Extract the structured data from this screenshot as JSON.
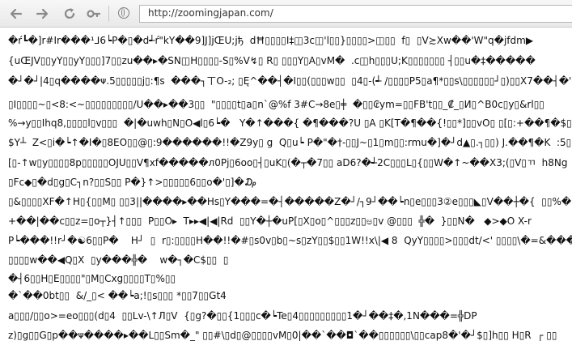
{
  "toolbar": {
    "back_icon": "back-arrow",
    "forward_icon": "forward-arrow",
    "reload_icon": "reload",
    "tools_icon": "wrench",
    "site_icon": "globe",
    "url": "http://zoomingjapan.com/"
  },
  "page": {
    "lines": [
      "�ŕ┗�]r#Ir���¹⅃6┕P�▯�d┵ŕ\"kY��9]J]jŒU;jђ  dĦ▯▯▯▯I‡◫3c◫'l▯▯}▯▯▯▯>◫▯▯  f▯  ▯V≿Xw��'W\"q�jfdm▶",
      "{uŒJV▯▯yY▯▯yY▯▯▯]7▯▯zu��▸�SN◫H▯▯▯▯-S▯%V↯▯ R▯ ▯▯▯Y▯A▯vM�  .c◫h▯▯▯U;K▯▯▯▯▯▯▯ ┤▯▯u�‡�����",
      "�┘�┘|4▯q����ᴪ.5▯▯▯▯▯j▯:¶s  ���┐ㄒO-₂; ▯Ę^��┤�I▯▯(▯▯▯w▯▯  ▯4▯-(┵ /▯▯▯▯P5▯a¶*▯▯s\\▯▯▯▯▯▯┘▯)▯▯X7��┤�'D",
      "▯I▯▯▯▯~▯<8:<~▯▯▯▯▯▯▯▯▯/U��▸��3▯▯  \"▯▯▯▯t▯a▯n`@%f 3#C→8e▯╪  �▯▯₢ym=▯▯FB't▯▯_₡_▯И▯^B0c▯y▯&rl▯▯",
      "%→y▯▯Ihq8,▯▯▯▯l▯v▯▯▯  �|�uwh▯N▯O◀l▯6┕�   Y�↑���{ �¶���?U ▯A ▯K[T�¶��{!▯▯*]▯▯vO▯ ▯[▯:+��¶�$▯▯V",
      "$Y┴  Z<▯i�┕↑�I�▯8EO▯▯@▯:9������!!�Z9y▯ g  Q▯u┕ P�\"�†-▯▯J~▯1▯m▯▯:rmu�]�┘d▲▯.┐▯▯) J.��¶�K  :5▯#8",
      "[▯-↑w▯y▯▯▯▯8p▯▯▯▯▯OJU▯▯V¶xf�����ᴫ0Pj▯6oo▯┤▯uK▯(�┬�7▯▯ aD6?�┵2C▯▯▯L▯{▯▯W�↑~��X3;(▯V▯ㄲ  h8Ng",
      "▯Fc◆▯�d▯g▯C┐n?▯▯S▯▯ P�}↑>▯▯▯▯▯6▯▯o�'▯]�₯",
      "▯&▯▯▯▯XF�↑H▯{▯▯M▯ ▯▯3||����▸��Hs▯Y���=�┤�����Z�┘/┐9┘��┕n▯e▯▯▯3②e▯▯▯◣▯V��┼�{  ▯▯%�¶]|8B-▯",
      "+��|��c▯▯z=▯o┬}┤↑▯▯▯  P▯▯O▸  T▸▸◀|◀|Rd  ▯▯Y�┼�uP[▯X▯o▯^▯▯▯z▯▯ಅ▯v @▯▯▯  ╬�  }▯▯N�   ◆>◆O X-r",
      "P┕���!!r┘�☯6▯▯P�    H┘  ▯  r▯:▯▯▯▯H��!!�#▯s0v▯b▯~s▯zY▯▯$▯▯1W!!x\\|◀ 8  QyY▯▯▯▯>▯▯▯dt/<' ▯▯▯▯\\�=&���",
      "▯▯▯▯w��◀Q▯X  ▯y���╬�    w�┐�C$▯▯  ▯",
      "�┤6▯▯H▯E▯▯▯▯\"▯M▯Cxg▯▯▯▯T▯%▯▯",
      "�`��0bt▯▯  &/_▯< ��┕a;!▯s▯▯▯ *▯▯7▯▯Gt4",
      "a▯▯▯/▯▯o>=eo▯▯▯(d▯4  ▯▯Lv-\\↑Л▯V  {▯g?�▯▯{1▯▯▯c�┕Te▯4▯▯▯▯▯▯▯▯▯1�┘��‡�,1N���=╬DP",
      "z)▯g▯▯G▯p��ᴪ����▸��L▯▯Sm�_\" ▯▯#\\▯d▯@▯▯▯▯vM▯0|��`��◘`��▯▯▯▯▯▯\\▯▯cap8�'�┘$▯]h▯▯ H▯R  ┌ ▯▯"
    ]
  }
}
